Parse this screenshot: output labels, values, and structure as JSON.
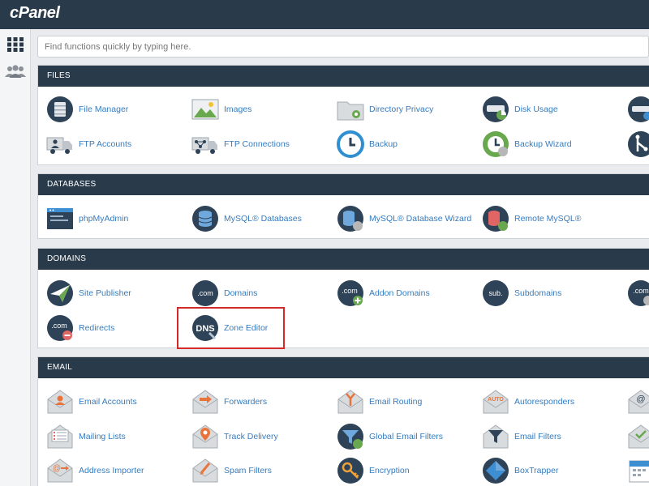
{
  "app": {
    "logo": "cPanel"
  },
  "search": {
    "placeholder": "Find functions quickly by typing here."
  },
  "sections": {
    "files": {
      "title": "FILES",
      "items": [
        {
          "label": "File Manager",
          "icon": "file-manager-icon"
        },
        {
          "label": "Images",
          "icon": "images-icon"
        },
        {
          "label": "Directory Privacy",
          "icon": "directory-privacy-icon"
        },
        {
          "label": "Disk Usage",
          "icon": "disk-usage-icon"
        },
        {
          "label": "",
          "icon": "web-disk-icon"
        },
        {
          "label": "FTP Accounts",
          "icon": "ftp-accounts-icon"
        },
        {
          "label": "FTP Connections",
          "icon": "ftp-connections-icon"
        },
        {
          "label": "Backup",
          "icon": "backup-icon"
        },
        {
          "label": "Backup Wizard",
          "icon": "backup-wizard-icon"
        },
        {
          "label": "",
          "icon": "git-icon"
        }
      ]
    },
    "databases": {
      "title": "DATABASES",
      "items": [
        {
          "label": "phpMyAdmin",
          "icon": "phpmyadmin-icon"
        },
        {
          "label": "MySQL® Databases",
          "icon": "mysql-databases-icon"
        },
        {
          "label": "MySQL® Database Wizard",
          "icon": "mysql-wizard-icon"
        },
        {
          "label": "Remote MySQL®",
          "icon": "remote-mysql-icon"
        }
      ]
    },
    "domains": {
      "title": "DOMAINS",
      "items": [
        {
          "label": "Site Publisher",
          "icon": "site-publisher-icon"
        },
        {
          "label": "Domains",
          "icon": "domains-icon",
          "badge": ".com"
        },
        {
          "label": "Addon Domains",
          "icon": "addon-domains-icon",
          "badge": ".com"
        },
        {
          "label": "Subdomains",
          "icon": "subdomains-icon",
          "badge": "sub."
        },
        {
          "label": "",
          "icon": "aliases-icon",
          "badge": ".com"
        },
        {
          "label": "Redirects",
          "icon": "redirects-icon",
          "badge": ".com"
        },
        {
          "label": "Zone Editor",
          "icon": "zone-editor-icon",
          "badge": "DNS"
        }
      ]
    },
    "email": {
      "title": "EMAIL",
      "items": [
        {
          "label": "Email Accounts",
          "icon": "email-accounts-icon"
        },
        {
          "label": "Forwarders",
          "icon": "forwarders-icon"
        },
        {
          "label": "Email Routing",
          "icon": "email-routing-icon"
        },
        {
          "label": "Autoresponders",
          "icon": "autoresponders-icon",
          "badge": "AUTO"
        },
        {
          "label": "",
          "icon": "default-address-icon"
        },
        {
          "label": "Mailing Lists",
          "icon": "mailing-lists-icon"
        },
        {
          "label": "Track Delivery",
          "icon": "track-delivery-icon"
        },
        {
          "label": "Global Email Filters",
          "icon": "global-email-filters-icon"
        },
        {
          "label": "Email Filters",
          "icon": "email-filters-icon"
        },
        {
          "label": "",
          "icon": "email-deliverability-icon"
        },
        {
          "label": "Address Importer",
          "icon": "address-importer-icon"
        },
        {
          "label": "Spam Filters",
          "icon": "spam-filters-icon"
        },
        {
          "label": "Encryption",
          "icon": "encryption-icon"
        },
        {
          "label": "BoxTrapper",
          "icon": "boxtrapper-icon"
        },
        {
          "label": "",
          "icon": "calendars-icon"
        }
      ]
    }
  },
  "colors": {
    "header": "#293a4a",
    "link": "#357cbf",
    "highlight": "#d42a2a",
    "icon_dark": "#2e4358"
  }
}
